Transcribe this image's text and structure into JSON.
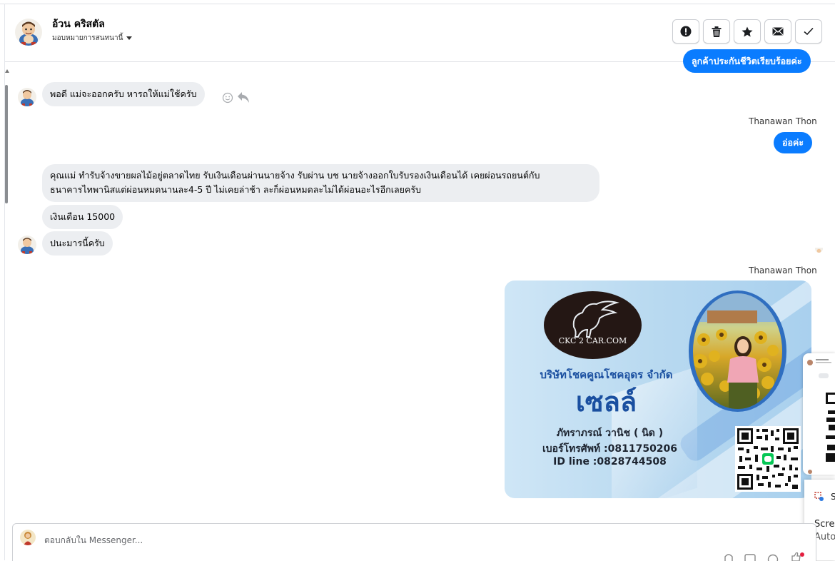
{
  "header": {
    "contact_name": "อ้วน คริสตัล",
    "assign_label": "มอบหมายการสนทนานี้",
    "actions": [
      "spam-icon",
      "trash-icon",
      "star-icon",
      "mail-icon",
      "check-icon"
    ]
  },
  "messages": {
    "partial_top": "ลูกค้าประกันชีวิตเรียบร้อยค่ะ",
    "m1": "พอดี แม่จะออกครับ หารถให้แม่ใช้ครับ",
    "sender1": "Thanawan Thon",
    "m2": "อ่อค่ะ",
    "m3_line1": "คุณแม่ ทำรับจ้างขายผลไม้อยู่ตลาดไทย รับเงินเดือนผ่านนายจ้าง รับผ่าน บช นายจ้างออกใบรับรองเงินเดือนได้ เคยผ่อนรถยนต์กับ",
    "m3_line2": "ธนาคารไทพานิสแต่ผ่อนหมดนานละ4-5 ปี ไม่เคยล่าช้า ละก็ผ่อนหมดละไม่ได้ผ่อนอะไรอีกเลยครับ",
    "m4": "เงินเดือน 15000",
    "m5": "ปนะมารนี้ครับ",
    "sender2": "Thanawan Thon"
  },
  "card": {
    "logo": "CKC 2 CAR.COM",
    "company": "บริษัทโชคคูณโชคอุดร จำกัด",
    "role": "เซลล์",
    "name": "ภัทราภรณ์  วานิช ( นิด )",
    "phone": "เบอร์โทรศัพท์ :0811750206",
    "line_id": "ID line :0828744508"
  },
  "toast": {
    "title": "Screen",
    "subtitle": "Auto"
  },
  "input": {
    "placeholder": "ตอบกลับใน Messenger..."
  },
  "colors": {
    "accent": "#0a7cff",
    "incoming_bubble": "#eceef1"
  }
}
